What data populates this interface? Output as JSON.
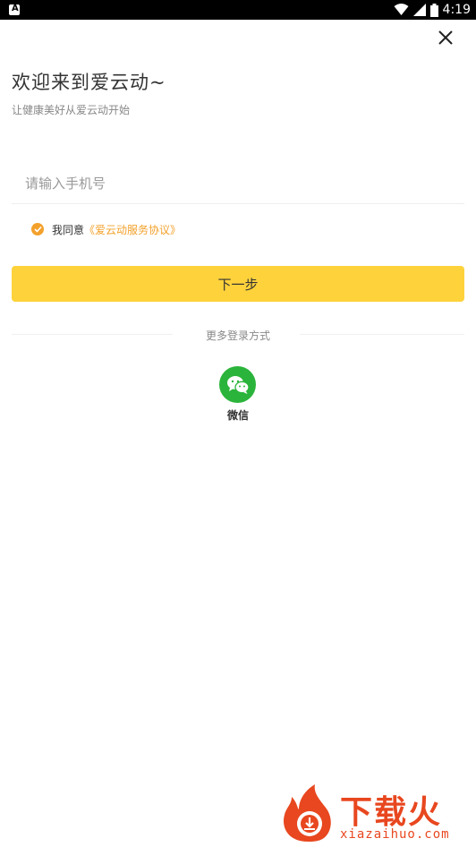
{
  "status_bar": {
    "time": "4:19"
  },
  "header": {
    "title": "欢迎来到爱云动~",
    "subtitle": "让健康美好从爱云动开始"
  },
  "phone_input": {
    "placeholder": "请输入手机号",
    "value": ""
  },
  "agreement": {
    "checked": true,
    "text": "我同意",
    "link": "《爱云动服务协议》"
  },
  "next_button": {
    "label": "下一步"
  },
  "more_login": {
    "label": "更多登录方式",
    "wechat_label": "微信"
  },
  "watermark": {
    "text": "下载火",
    "url": "xiazaihuo.com"
  },
  "colors": {
    "accent": "#fed23b",
    "link": "#f3a12b",
    "wechat": "#2bb43b"
  }
}
